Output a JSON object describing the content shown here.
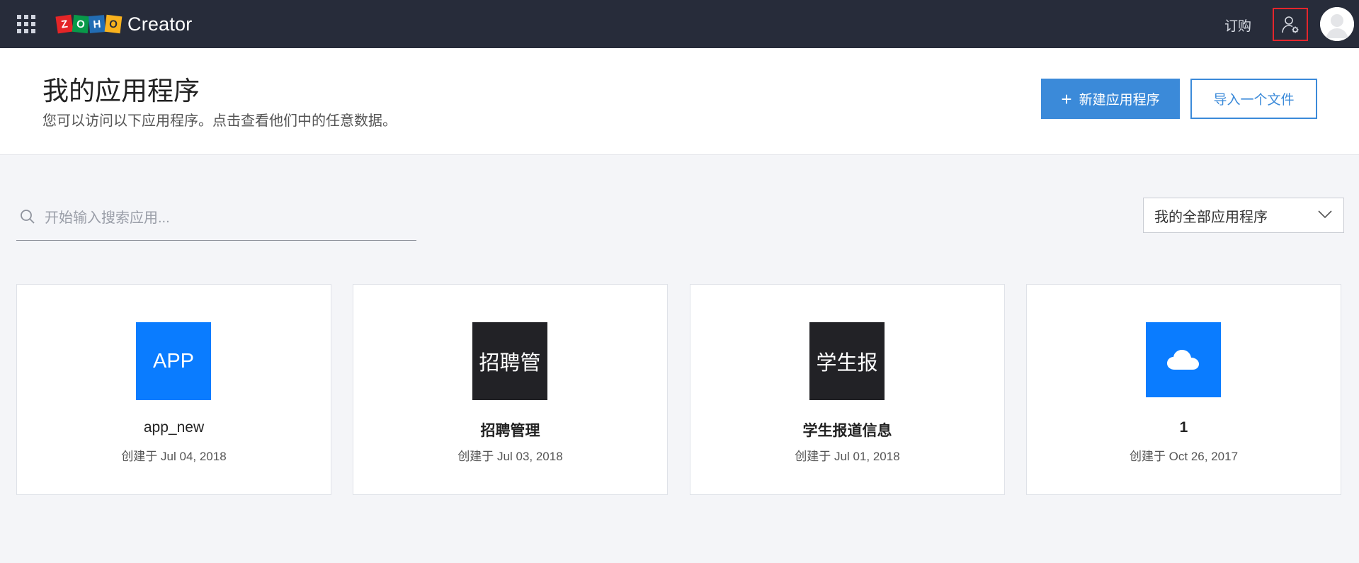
{
  "topbar": {
    "brand_letters": [
      "Z",
      "O",
      "H",
      "O"
    ],
    "product": "Creator",
    "subscribe_label": "订购"
  },
  "header": {
    "title": "我的应用程序",
    "subtitle": "您可以访问以下应用程序。点击查看他们中的任意数据。",
    "new_app_label": "新建应用程序",
    "import_label": "导入一个文件"
  },
  "search": {
    "placeholder": "开始输入搜索应用..."
  },
  "filter": {
    "selected": "我的全部应用程序"
  },
  "apps": [
    {
      "icon_text": "APP",
      "icon_color": "#0a7cff",
      "name": "app_new",
      "created": "创建于 Jul 04, 2018"
    },
    {
      "icon_text": "招聘管",
      "icon_color": "#222226",
      "name": "招聘管理",
      "created": "创建于 Jul 03, 2018"
    },
    {
      "icon_text": "学生报",
      "icon_color": "#222226",
      "name": "学生报道信息",
      "created": "创建于 Jul 01, 2018"
    },
    {
      "icon_text": "",
      "icon_color": "#0a7cff",
      "name": "1",
      "created": "创建于 Oct 26, 2017",
      "icon": "cloud-icon"
    }
  ],
  "colors": {
    "topbar_bg": "#272c3a",
    "accent": "#3b8ad9",
    "highlight_border": "#e4262c"
  }
}
